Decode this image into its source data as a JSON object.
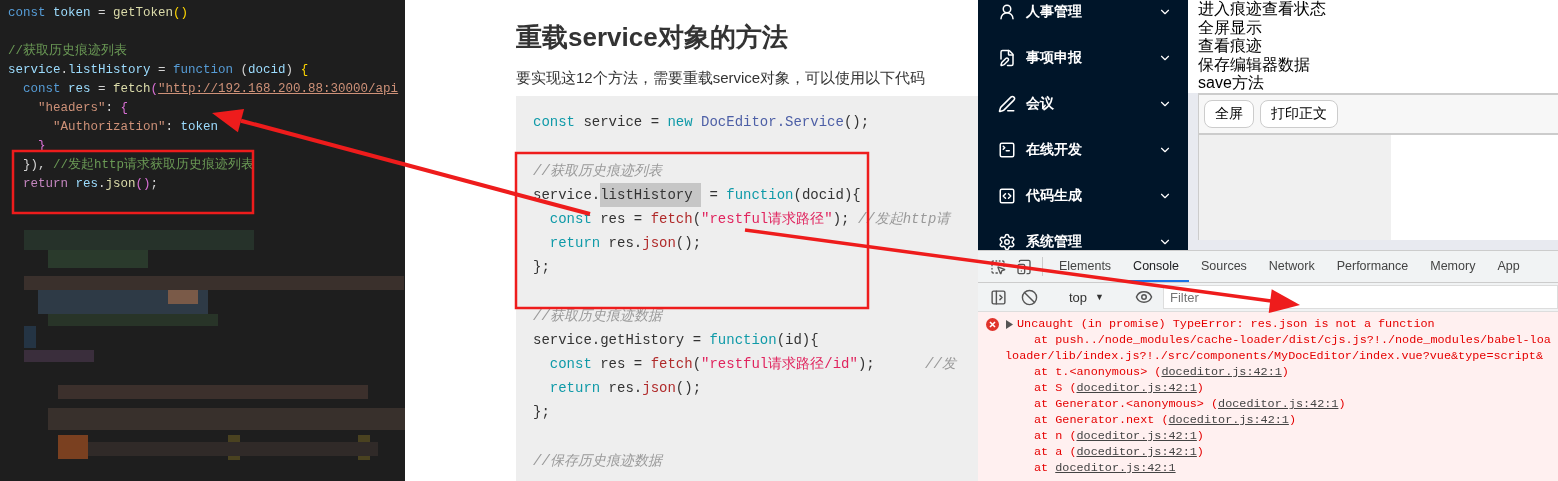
{
  "editor": {
    "lines": [
      {
        "tokens": [
          {
            "t": "const ",
            "kind": "kw"
          },
          {
            "t": "token",
            "kind": "var"
          },
          {
            "t": " = ",
            "kind": "punc"
          },
          {
            "t": "getToken",
            "kind": "fn"
          },
          {
            "t": "()",
            "kind": "brace"
          }
        ]
      },
      {
        "space_before": true,
        "tokens": [
          {
            "t": "//获取历史痕迹列表",
            "kind": "comment"
          }
        ]
      },
      {
        "tokens": [
          {
            "t": "service",
            "kind": "var"
          },
          {
            "t": ".",
            "kind": "punc"
          },
          {
            "t": "listHistory",
            "kind": "var"
          },
          {
            "t": " = ",
            "kind": "punc"
          },
          {
            "t": "function",
            "kind": "kw"
          },
          {
            "t": " (",
            "kind": "punc"
          },
          {
            "t": "docid",
            "kind": "param"
          },
          {
            "t": ") ",
            "kind": "punc"
          },
          {
            "t": "{",
            "kind": "brace"
          }
        ]
      },
      {
        "tokens": [
          {
            "t": "  const ",
            "kind": "kw"
          },
          {
            "t": "res",
            "kind": "var"
          },
          {
            "t": " = ",
            "kind": "punc"
          },
          {
            "t": "fetch",
            "kind": "fn"
          },
          {
            "t": "(",
            "kind": "paren"
          },
          {
            "t": "\"http://192.168.200.88:30000/api",
            "kind": "url"
          }
        ]
      },
      {
        "tokens": [
          {
            "t": "    \"headers\"",
            "kind": "str"
          },
          {
            "t": ": ",
            "kind": "punc"
          },
          {
            "t": "{",
            "kind": "paren"
          }
        ]
      },
      {
        "tokens": [
          {
            "t": "      \"Authorization\"",
            "kind": "str"
          },
          {
            "t": ": ",
            "kind": "punc"
          },
          {
            "t": "token",
            "kind": "var"
          }
        ]
      },
      {
        "tokens": [
          {
            "t": "    }",
            "kind": "paren"
          }
        ]
      },
      {
        "tokens": [
          {
            "t": "  })",
            "kind": "punc"
          },
          {
            "t": ", ",
            "kind": "punc"
          },
          {
            "t": "//发起http请求获取历史痕迹列表",
            "kind": "comment"
          }
        ]
      },
      {
        "tokens": [
          {
            "t": "  return ",
            "kind": "ctrl"
          },
          {
            "t": "res",
            "kind": "var"
          },
          {
            "t": ".",
            "kind": "punc"
          },
          {
            "t": "json",
            "kind": "fn"
          },
          {
            "t": "()",
            "kind": "paren"
          },
          {
            "t": ";",
            "kind": "punc"
          }
        ]
      }
    ]
  },
  "doc": {
    "heading": "重载service对象的方法",
    "intro": "要实现这12个方法，需要重载service对象，可以使用以下代码",
    "code": [
      {
        "tokens": [
          {
            "t": "const",
            "kind": "kw"
          },
          {
            "t": " service = ",
            "kind": "plain"
          },
          {
            "t": "new",
            "kind": "kw"
          },
          {
            "t": " DocEditor.Service",
            "kind": "cls"
          },
          {
            "t": "();",
            "kind": "plain"
          }
        ]
      },
      {
        "space_before": true,
        "tokens": [
          {
            "t": "//获取历史痕迹列表",
            "kind": "comment"
          }
        ]
      },
      {
        "tokens": [
          {
            "t": "service.",
            "kind": "plain"
          },
          {
            "t": "listHistory ",
            "kind": "mark"
          },
          {
            "t": " = ",
            "kind": "plain"
          },
          {
            "t": "function",
            "kind": "kw"
          },
          {
            "t": "(docid){",
            "kind": "plain"
          }
        ]
      },
      {
        "tokens": [
          {
            "t": "  const",
            "kind": "kw"
          },
          {
            "t": " res = ",
            "kind": "plain"
          },
          {
            "t": "fetch",
            "kind": "fn"
          },
          {
            "t": "(",
            "kind": "plain"
          },
          {
            "t": "\"restful请求路径\"",
            "kind": "str"
          },
          {
            "t": "); ",
            "kind": "plain"
          },
          {
            "t": "//发起http请",
            "kind": "comment"
          }
        ]
      },
      {
        "tokens": [
          {
            "t": "  return",
            "kind": "kw"
          },
          {
            "t": " res.",
            "kind": "plain"
          },
          {
            "t": "json",
            "kind": "fn"
          },
          {
            "t": "();",
            "kind": "plain"
          }
        ]
      },
      {
        "tokens": [
          {
            "t": "};",
            "kind": "plain"
          }
        ]
      },
      {
        "space_before": true,
        "tokens": [
          {
            "t": "//获取历史痕迹数据",
            "kind": "comment"
          }
        ]
      },
      {
        "tokens": [
          {
            "t": "service.getHistory = ",
            "kind": "plain"
          },
          {
            "t": "function",
            "kind": "kw"
          },
          {
            "t": "(id){",
            "kind": "plain"
          }
        ]
      },
      {
        "tokens": [
          {
            "t": "  const",
            "kind": "kw"
          },
          {
            "t": " res = ",
            "kind": "plain"
          },
          {
            "t": "fetch",
            "kind": "fn"
          },
          {
            "t": "(",
            "kind": "plain"
          },
          {
            "t": "\"restful请求路径/id\"",
            "kind": "str"
          },
          {
            "t": ");      ",
            "kind": "plain"
          },
          {
            "t": "//发",
            "kind": "comment"
          }
        ]
      },
      {
        "tokens": [
          {
            "t": "  return",
            "kind": "kw"
          },
          {
            "t": " res.",
            "kind": "plain"
          },
          {
            "t": "json",
            "kind": "fn"
          },
          {
            "t": "();",
            "kind": "plain"
          }
        ]
      },
      {
        "tokens": [
          {
            "t": "};",
            "kind": "plain"
          }
        ]
      },
      {
        "space_before": true,
        "tokens": [
          {
            "t": "//保存历史痕迹数据",
            "kind": "comment"
          }
        ]
      }
    ]
  },
  "app": {
    "sidebar": {
      "items": [
        {
          "label": "人事管理"
        },
        {
          "label": "事项申报"
        },
        {
          "label": "会议"
        },
        {
          "label": "在线开发"
        },
        {
          "label": "代码生成"
        },
        {
          "label": "系统管理"
        }
      ]
    },
    "lines": [
      "进入痕迹查看状态",
      "全屏显示",
      "查看痕迹",
      "保存编辑器数据",
      "save方法"
    ],
    "buttons": [
      "全屏",
      "打印正文"
    ]
  },
  "devtools": {
    "tabs": [
      {
        "label": "Elements",
        "selected": false
      },
      {
        "label": "Console",
        "selected": true
      },
      {
        "label": "Sources",
        "selected": false
      },
      {
        "label": "Network",
        "selected": false
      },
      {
        "label": "Performance",
        "selected": false
      },
      {
        "label": "Memory",
        "selected": false
      },
      {
        "label": "App",
        "selected": false
      }
    ],
    "context": "top",
    "context_caret": "▼",
    "filter_placeholder": "Filter",
    "error": {
      "message": "Uncaught (in promise) TypeError: res.json is not a function",
      "stack": [
        {
          "wrapped": false,
          "parts": [
            {
              "t": "at push../node_modules/cache-loader/dist/cjs.js?!./node_modules/babel-loa",
              "kind": "text"
            }
          ]
        },
        {
          "wrapped": true,
          "parts": [
            {
              "t": "loader/lib/index.js?!./src/components/MyDocEditor/index.vue?vue&type=script&",
              "kind": "text"
            }
          ]
        },
        {
          "wrapped": false,
          "parts": [
            {
              "t": "at t.<anonymous> (",
              "kind": "text"
            },
            {
              "t": "doceditor.js:42:1",
              "kind": "link"
            },
            {
              "t": ")",
              "kind": "text"
            }
          ]
        },
        {
          "wrapped": false,
          "parts": [
            {
              "t": "at S (",
              "kind": "text"
            },
            {
              "t": "doceditor.js:42:1",
              "kind": "link"
            },
            {
              "t": ")",
              "kind": "text"
            }
          ]
        },
        {
          "wrapped": false,
          "parts": [
            {
              "t": "at Generator.<anonymous> (",
              "kind": "text"
            },
            {
              "t": "doceditor.js:42:1",
              "kind": "link"
            },
            {
              "t": ")",
              "kind": "text"
            }
          ]
        },
        {
          "wrapped": false,
          "parts": [
            {
              "t": "at Generator.next (",
              "kind": "text"
            },
            {
              "t": "doceditor.js:42:1",
              "kind": "link"
            },
            {
              "t": ")",
              "kind": "text"
            }
          ]
        },
        {
          "wrapped": false,
          "parts": [
            {
              "t": "at n (",
              "kind": "text"
            },
            {
              "t": "doceditor.js:42:1",
              "kind": "link"
            },
            {
              "t": ")",
              "kind": "text"
            }
          ]
        },
        {
          "wrapped": false,
          "parts": [
            {
              "t": "at a (",
              "kind": "text"
            },
            {
              "t": "doceditor.js:42:1",
              "kind": "link"
            },
            {
              "t": ")",
              "kind": "text"
            }
          ]
        },
        {
          "wrapped": false,
          "parts": [
            {
              "t": "at ",
              "kind": "text"
            },
            {
              "t": "doceditor.js:42:1",
              "kind": "link"
            }
          ]
        }
      ]
    }
  }
}
